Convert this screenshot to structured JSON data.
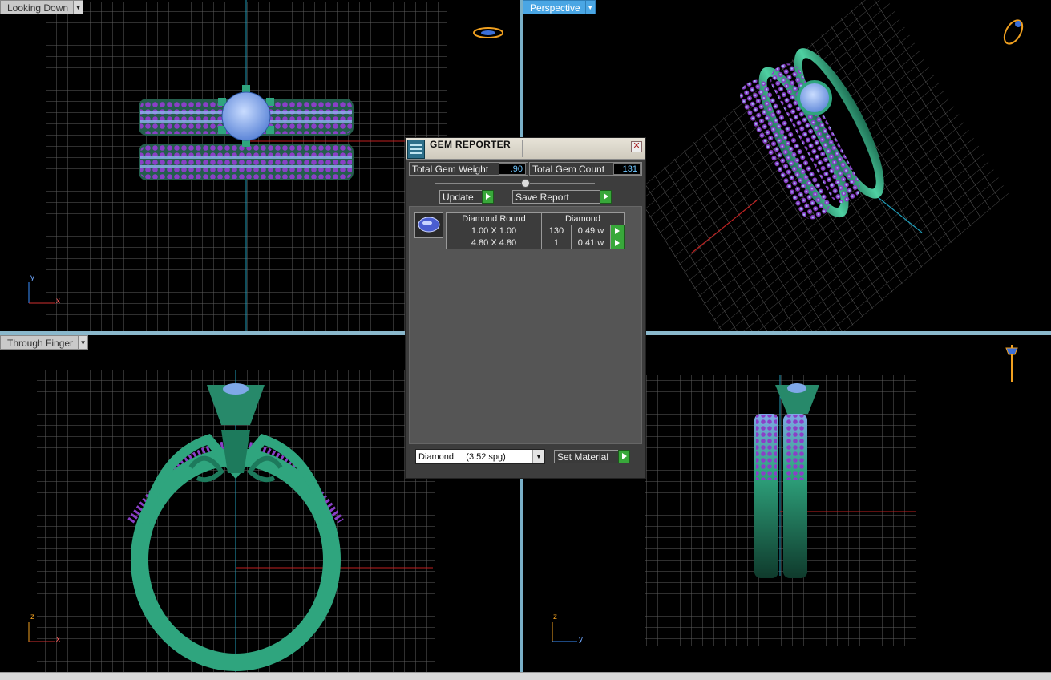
{
  "viewports": {
    "top_left": {
      "label": "Looking Down",
      "axis_v": "y",
      "axis_h": "x"
    },
    "top_right": {
      "label": "Perspective"
    },
    "bottom_left": {
      "label": "Through Finger",
      "axis_v": "z",
      "axis_h": "x"
    },
    "bottom_right": {
      "axis_v": "z",
      "axis_h": "y"
    }
  },
  "gem_reporter": {
    "title": "GEM REPORTER",
    "close_symbol": "✕",
    "total_weight_label": "Total Gem Weight",
    "total_weight_value": ".90",
    "total_count_label": "Total Gem Count",
    "total_count_value": "131",
    "update_label": "Update",
    "save_report_label": "Save Report",
    "table": {
      "headers": [
        "Diamond Round",
        "Diamond"
      ],
      "rows": [
        {
          "size": "1.00 X 1.00",
          "count": "130",
          "weight": "0.49tw"
        },
        {
          "size": "4.80 X 4.80",
          "count": "1",
          "weight": "0.41tw"
        }
      ]
    },
    "material_value": "Diamond     (3.52 spg)",
    "set_material_label": "Set Material"
  },
  "colors": {
    "metal": "#2fa57e",
    "gem_small": "#8a3fc7",
    "gem_light": "#7fa8e8",
    "grid": "#6a6a6a",
    "active_tab": "#4aa6e4"
  }
}
